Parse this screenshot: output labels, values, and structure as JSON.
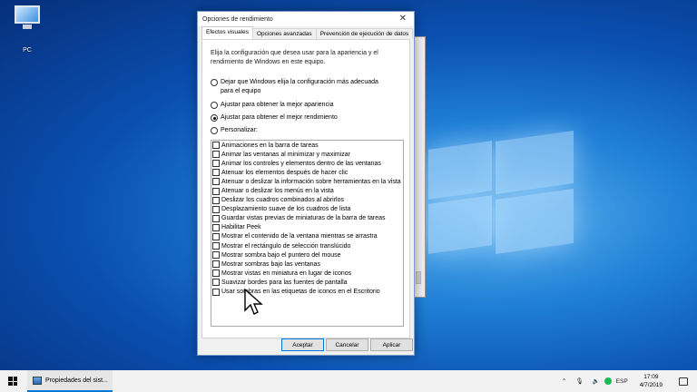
{
  "desktop": {
    "icon_label": "PC"
  },
  "dialog": {
    "title": "Opciones de rendimiento",
    "tabs": [
      "Efectos visuales",
      "Opciones avanzadas",
      "Prevención de ejecución de datos"
    ],
    "description": "Elija la configuración que desea usar para la apariencia y el rendimiento de Windows en este equipo.",
    "radios": [
      {
        "label": "Dejar que Windows elija la configuración más adecuada para el equipo",
        "selected": false
      },
      {
        "label": "Ajustar para obtener la mejor apariencia",
        "selected": false
      },
      {
        "label": "Ajustar para obtener el mejor rendimiento",
        "selected": true
      },
      {
        "label": "Personalizar:",
        "selected": false
      }
    ],
    "checkboxes": [
      "Animaciones en la barra de tareas",
      "Animar las ventanas al minimizar y maximizar",
      "Animar los controles y elementos dentro de las ventanas",
      "Atenuar los elementos después de hacer clic",
      "Atenuar o deslizar la información sobre herramientas en la vista",
      "Atenuar o deslizar los menús en la vista",
      "Deslizar los cuadros combinados al abrirlos",
      "Desplazamiento suave de los cuadros de lista",
      "Guardar vistas previas de miniaturas de la barra de tareas",
      "Habilitar Peek",
      "Mostrar el contenido de la ventana mientras se arrastra",
      "Mostrar el rectángulo de selección translúcido",
      "Mostrar sombra bajo el puntero del mouse",
      "Mostrar sombras bajo las ventanas",
      "Mostrar vistas en miniatura en lugar de iconos",
      "Suavizar bordes para las fuentes de pantalla",
      "Usar sombras en las etiquetas de iconos en el Escritorio"
    ],
    "buttons": {
      "ok": "Aceptar",
      "cancel": "Cancelar",
      "apply": "Aplicar"
    }
  },
  "taskbar": {
    "task_label": "Propiedades del sist...",
    "language": "ESP",
    "time": "17:09",
    "date": "4/7/2019"
  }
}
